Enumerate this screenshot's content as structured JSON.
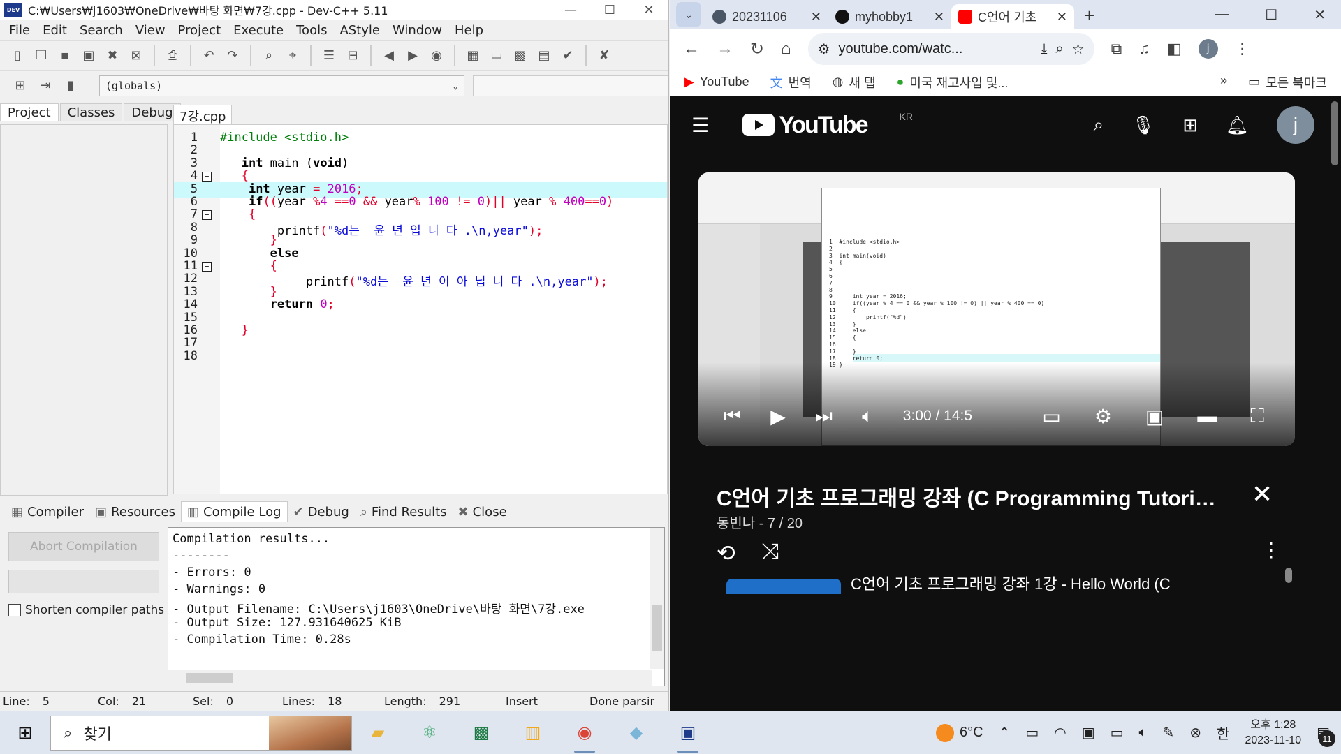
{
  "devcpp": {
    "title": "C:₩Users₩j1603₩OneDrive₩바탕 화면₩7강.cpp - Dev-C++ 5.11",
    "menu": [
      "File",
      "Edit",
      "Search",
      "View",
      "Project",
      "Execute",
      "Tools",
      "AStyle",
      "Window",
      "Help"
    ],
    "globals_value": "(globals)",
    "left_tabs": [
      "Project",
      "Classes",
      "Debug"
    ],
    "file_tab": "7강.cpp",
    "code_lines": [
      {
        "n": "1",
        "html": "<span class='c-pp'>#include &lt;stdio.h&gt;</span>",
        "fold": ""
      },
      {
        "n": "2",
        "html": "",
        "fold": ""
      },
      {
        "n": "3",
        "html": "   <span class='c-kw'>int</span> main (<span class='c-kw'>void</span>)",
        "fold": ""
      },
      {
        "n": "4",
        "html": "   <span class='c-op'>{</span>",
        "fold": "−"
      },
      {
        "n": "5",
        "html": "    <span class='c-kw'>int</span> year <span class='c-op'>=</span> <span class='c-num'>2016</span><span class='c-op'>;</span>",
        "fold": ""
      },
      {
        "n": "6",
        "html": "    <span class='c-kw'>if</span><span class='c-op'>((</span>year <span class='c-op'>%</span><span class='c-num'>4</span> <span class='c-op'>==</span><span class='c-num'>0</span> <span class='c-op'>&amp;&amp;</span> year<span class='c-op'>%</span> <span class='c-num'>100</span> <span class='c-op'>!=</span> <span class='c-num'>0</span><span class='c-op'>)||</span> year <span class='c-op'>%</span> <span class='c-num'>400</span><span class='c-op'>==</span><span class='c-num'>0</span><span class='c-op'>)</span>",
        "fold": ""
      },
      {
        "n": "7",
        "html": "    <span class='c-op'>{</span>",
        "fold": "−"
      },
      {
        "n": "8",
        "html": "        printf<span class='c-op'>(</span><span class='c-str'>\"%d는  윤 년 입 니 다 .\\n,year\"</span><span class='c-op'>);</span>",
        "fold": ""
      },
      {
        "n": "9",
        "html": "       <span class='c-op'>}</span>",
        "fold": ""
      },
      {
        "n": "10",
        "html": "       <span class='c-kw'>else</span>",
        "fold": ""
      },
      {
        "n": "11",
        "html": "       <span class='c-op'>{</span>",
        "fold": "−"
      },
      {
        "n": "12",
        "html": "            printf<span class='c-op'>(</span><span class='c-str'>\"%d는  윤 년 이 아 닙 니 다 .\\n,year\"</span><span class='c-op'>);</span>",
        "fold": ""
      },
      {
        "n": "13",
        "html": "       <span class='c-op'>}</span>",
        "fold": ""
      },
      {
        "n": "14",
        "html": "       <span class='c-kw'>return</span> <span class='c-num'>0</span><span class='c-op'>;</span>",
        "fold": ""
      },
      {
        "n": "15",
        "html": "",
        "fold": ""
      },
      {
        "n": "16",
        "html": "   <span class='c-op'>}</span>",
        "fold": ""
      },
      {
        "n": "17",
        "html": "",
        "fold": ""
      },
      {
        "n": "18",
        "html": "",
        "fold": ""
      }
    ],
    "bottom_tabs": [
      "Compiler",
      "Resources",
      "Compile Log",
      "Debug",
      "Find Results",
      "Close"
    ],
    "abort_label": "Abort Compilation",
    "shorten_label": "Shorten compiler paths",
    "log_lines": [
      "Compilation results...",
      "--------",
      "- Errors: 0",
      "- Warnings: 0",
      "- Output Filename: C:\\Users\\j1603\\OneDrive\\바탕 화면\\7강.exe",
      "- Output Size: 127.931640625 KiB",
      "- Compilation Time: 0.28s"
    ],
    "status": {
      "line_label": "Line:",
      "line": "5",
      "col_label": "Col:",
      "col": "21",
      "sel_label": "Sel:",
      "sel": "0",
      "lines_label": "Lines:",
      "lines": "18",
      "length_label": "Length:",
      "length": "291",
      "mode": "Insert",
      "state": "Done parsir"
    }
  },
  "chrome": {
    "tabs": [
      {
        "title": "20231106",
        "color": "#4a5565"
      },
      {
        "title": "myhobby1",
        "color": "#111"
      },
      {
        "title": "C언어 기초",
        "color": "#ff0000"
      }
    ],
    "url": "youtube.com/watc...",
    "bookmarks": [
      "YouTube",
      "번역",
      "새 탭",
      "미국 재고사입 및..."
    ],
    "all_bookmarks": "모든 북마크"
  },
  "youtube": {
    "logo": "YouTube",
    "region": "KR",
    "avatar_letter": "j",
    "time": "3:00 / 14:5",
    "progress_fraction": 0.168,
    "buffered_fraction": 0.295,
    "video_title": "C언어 기초 프로그래밍 강좌 (C Programming Tutoria...",
    "channel": "동빈나",
    "position": "7 / 20",
    "next_title": "C언어 기초 프로그래밍 강좌 1강 - Hello World (C",
    "inner_code": "1  #include <stdio.h>\n2\n3  int main(void)\n4  {\n5\n6\n7\n8\n9      int year = 2016;\n10     if((year % 4 == 0 && year % 100 != 0) || year % 400 == 0)\n11     {\n12         printf(\"%d\")\n13     }\n14     else\n15     {\n16\n17     }\n18     return 0;\n19 }"
  },
  "taskbar": {
    "search_placeholder": "찾기",
    "temperature": "6°C",
    "ime": "한",
    "time": "오후 1:28",
    "date": "2023-11-10",
    "notifications": "11"
  }
}
